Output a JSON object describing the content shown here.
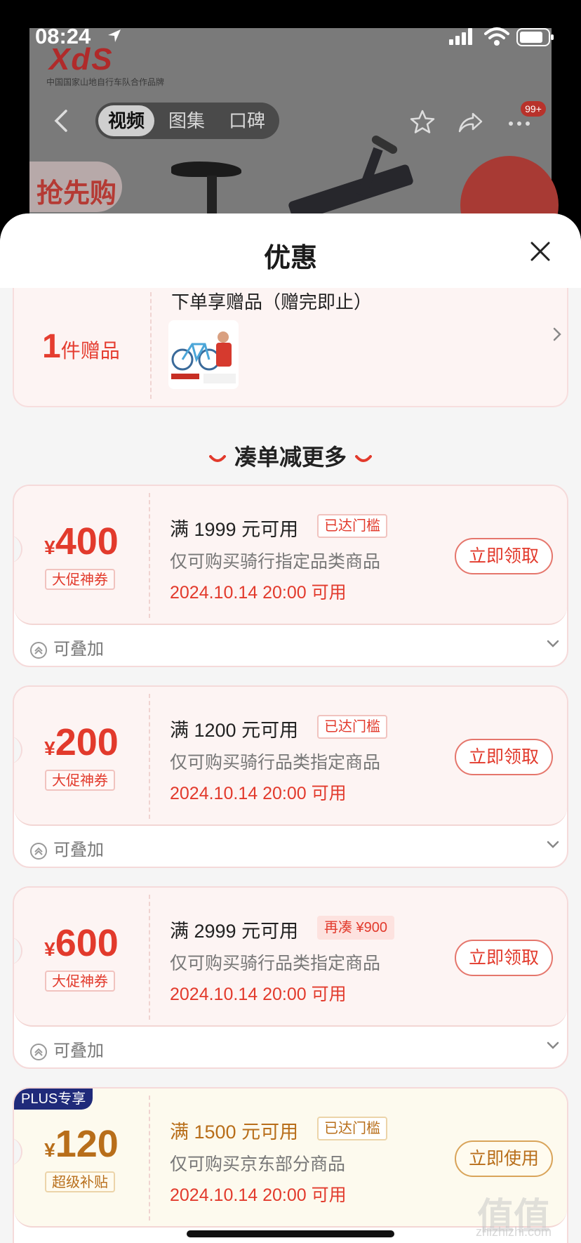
{
  "status_bar": {
    "time": "08:24",
    "location_icon": "location-arrow-icon",
    "signal_icon": "cellular-signal-icon",
    "wifi_icon": "wifi-icon",
    "battery_icon": "battery-icon"
  },
  "background_page": {
    "logo_text": "XdS",
    "logo_subtitle": "中国国家山地自行车队合作品牌",
    "tabs": [
      {
        "label": "视频",
        "active": true
      },
      {
        "label": "图集",
        "active": false
      },
      {
        "label": "口碑",
        "active": false
      }
    ],
    "banner_badge": "抢先购",
    "cart_badge": "99+"
  },
  "sheet": {
    "title": "优惠",
    "close_icon": "close-icon"
  },
  "gift": {
    "title": "下单享赠品（赠完即止）",
    "count": "1",
    "unit": "件赠品"
  },
  "section": {
    "title": "凑单减更多"
  },
  "coupons": [
    {
      "currency": "¥",
      "amount": "400",
      "tag": "大促神券",
      "condition": "满 1999 元可用",
      "status": "已达门槛",
      "scope": "仅可购买骑行指定品类商品",
      "time": "2024.10.14 20:00 可用",
      "action": "立即领取",
      "stack": "可叠加"
    },
    {
      "currency": "¥",
      "amount": "200",
      "tag": "大促神券",
      "condition": "满 1200 元可用",
      "status": "已达门槛",
      "scope": "仅可购买骑行品类指定商品",
      "time": "2024.10.14 20:00 可用",
      "action": "立即领取",
      "stack": "可叠加"
    },
    {
      "currency": "¥",
      "amount": "600",
      "tag": "大促神券",
      "condition": "满 2999 元可用",
      "status": "再凑 ¥900",
      "scope": "仅可购买骑行品类指定商品",
      "time": "2024.10.14 20:00 可用",
      "action": "立即领取",
      "stack": "可叠加"
    },
    {
      "badge": "PLUS专享",
      "currency": "¥",
      "amount": "120",
      "tag": "超级补贴",
      "condition": "满 1500 元可用",
      "status": "已达门槛",
      "scope": "仅可购买京东部分商品",
      "time": "2024.10.14 20:00 可用",
      "action": "立即使用"
    }
  ],
  "watermark": {
    "text": "值值值",
    "sub": "zhizhizhi.com"
  },
  "colors": {
    "accent_red": "#e23a2c",
    "plus_gold": "#b86e1a",
    "plus_navy": "#1f2a7a"
  }
}
